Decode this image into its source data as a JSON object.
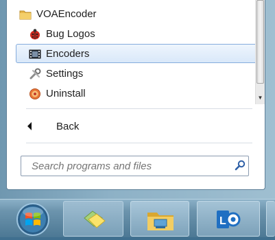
{
  "menu": {
    "folder": {
      "label": "VOAEncoder",
      "icon": "folder-icon"
    },
    "items": [
      {
        "label": "Bug Logos",
        "icon": "ladybug-icon"
      },
      {
        "label": "Encoders",
        "icon": "film-icon",
        "selected": true
      },
      {
        "label": "Settings",
        "icon": "wrench-icon"
      },
      {
        "label": "Uninstall",
        "icon": "uninstall-icon"
      }
    ],
    "back_label": "Back"
  },
  "search": {
    "placeholder": "Search programs and files"
  },
  "taskbar": {
    "buttons": [
      {
        "name": "start",
        "icon": "windows-orb-icon"
      },
      {
        "name": "sticky-notes",
        "icon": "sticky-notes-icon"
      },
      {
        "name": "explorer",
        "icon": "folder-icon"
      },
      {
        "name": "lync",
        "icon": "lync-icon"
      }
    ]
  },
  "colors": {
    "selection": "#d9e8f9",
    "selection_border": "#84acdd",
    "taskbar": "#4c7894"
  }
}
